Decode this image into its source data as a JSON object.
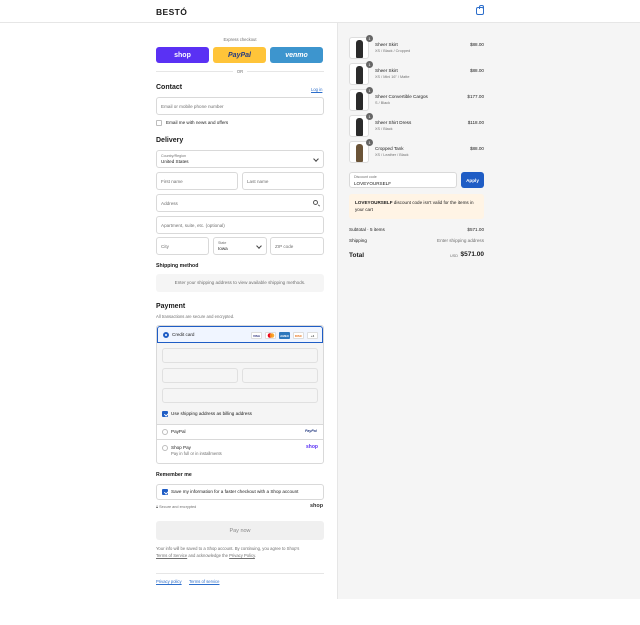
{
  "header": {
    "logo": "BESTÓ",
    "cart_icon": "shopping-bag-icon"
  },
  "express": {
    "label": "Express checkout",
    "buttons": {
      "shop": "shop",
      "paypal": "PayPal",
      "venmo": "venmo"
    },
    "or": "OR"
  },
  "contact": {
    "title": "Contact",
    "login": "Log in",
    "email_placeholder": "Email or mobile phone number",
    "news_label": "Email me with news and offers"
  },
  "delivery": {
    "title": "Delivery",
    "country_label": "Country/Region",
    "country_value": "United States",
    "first_name": "First name",
    "last_name": "Last name",
    "address": "Address",
    "apartment": "Apartment, suite, etc. (optional)",
    "city": "City",
    "state_label": "State",
    "state_value": "Iowa",
    "zip": "ZIP code"
  },
  "shipping": {
    "title": "Shipping method",
    "message": "Enter your shipping address to view available shipping methods."
  },
  "payment": {
    "title": "Payment",
    "subtitle": "All transactions are secure and encrypted.",
    "credit_card": "Credit card",
    "card_logos": [
      "VISA",
      "MC",
      "AMEX",
      "DISC",
      "+4"
    ],
    "billing_label": "Use shipping address as billing address",
    "paypal": "PayPal",
    "paypal_logo": "PayPal",
    "shop_pay": "Shop Pay",
    "shop_pay_sub": "Pay in full or in installments",
    "shop_logo": "shop"
  },
  "remember": {
    "title": "Remember me",
    "label": "Save my information for a faster checkout with a Shop account",
    "secure": "Secure and encrypted",
    "shop_logo": "shop"
  },
  "pay_now": "Pay now",
  "disclaimer": {
    "line1": "Your info will be saved to a Shop account. By continuing, you agree to Shop's",
    "terms": "Terms of Service",
    "mid": "and acknowledge the",
    "privacy": "Privacy Policy",
    "end": "."
  },
  "footer": {
    "privacy": "Privacy policy",
    "terms": "Terms of service"
  },
  "cart": {
    "items": [
      {
        "qty": "1",
        "name": "Sheer Skirt",
        "variant": "XS / Black / Cropped",
        "price": "$88.00"
      },
      {
        "qty": "1",
        "name": "Sheer Skirt",
        "variant": "XS / Mini 16\" / Matte",
        "price": "$88.00"
      },
      {
        "qty": "1",
        "name": "Sheer Convertible Cargos",
        "variant": "S / Black",
        "price": "$177.00"
      },
      {
        "qty": "1",
        "name": "Sheer Shirt Dress",
        "variant": "XS / Black",
        "price": "$118.00"
      },
      {
        "qty": "1",
        "name": "Cropped Tank",
        "variant": "XS / Leather / Black",
        "price": "$88.00"
      }
    ],
    "discount_label": "Discount code",
    "discount_value": "LOVEYOURSELF",
    "apply": "Apply",
    "warning_code": "LOVEYOURSELF",
    "warning_text": " discount code isn't valid for the items in your cart",
    "subtotal_label": "Subtotal · 5 items",
    "subtotal_value": "$571.00",
    "shipping_label": "Shipping",
    "shipping_value": "Enter shipping address",
    "total_label": "Total",
    "currency": "USD",
    "total_value": "$571.00"
  },
  "colors": {
    "accent": "#1f5dc5",
    "shop_purple": "#5a31f4",
    "paypal_yellow": "#ffc439",
    "venmo_blue": "#3d95ce"
  }
}
